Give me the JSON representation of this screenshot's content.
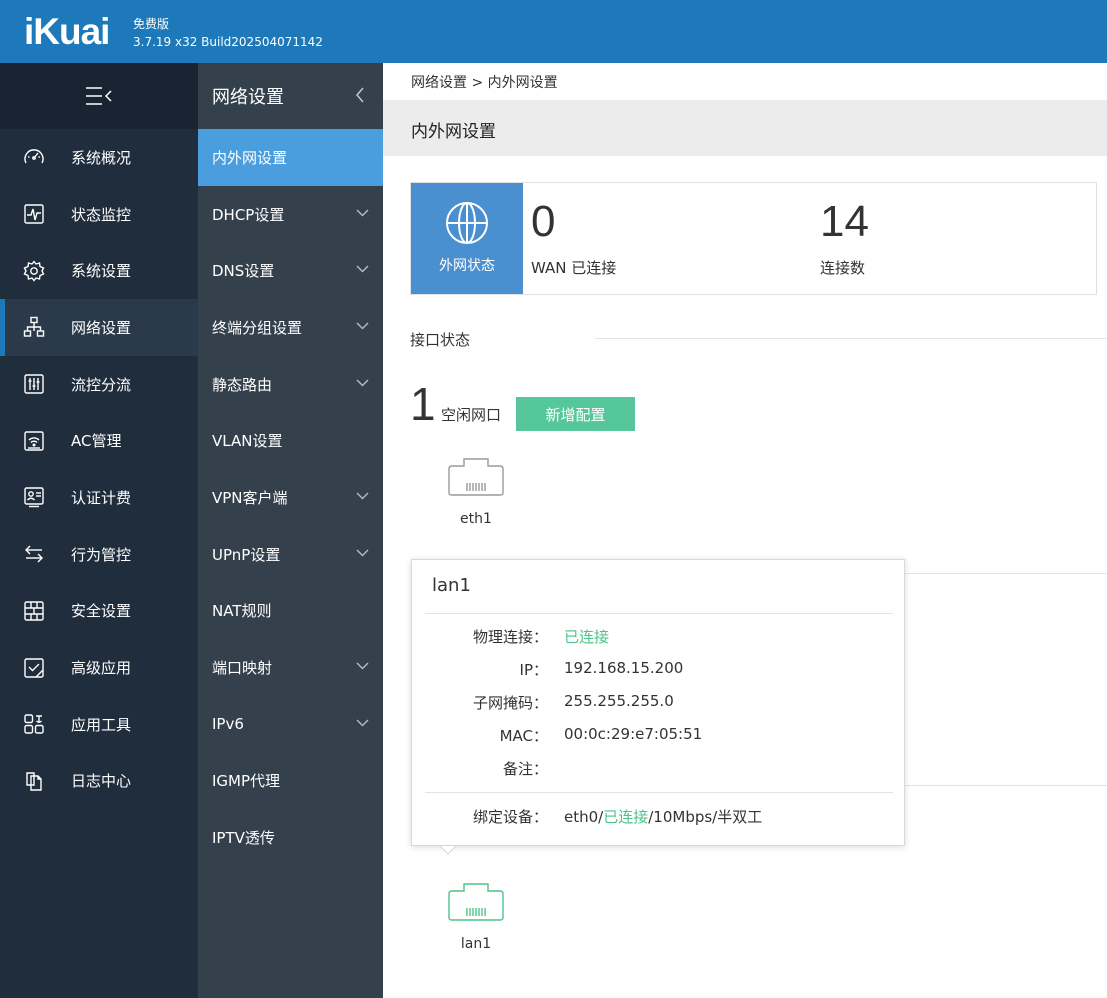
{
  "header": {
    "logo": "iKuai",
    "edition": "免费版",
    "build": "3.7.19 x32 Build202504071142",
    "bg_color": "#1d79b9"
  },
  "sidebar": {
    "items": [
      {
        "label": "系统概况",
        "icon": "speedometer-icon"
      },
      {
        "label": "状态监控",
        "icon": "heartbeat-monitor-icon"
      },
      {
        "label": "系统设置",
        "icon": "gear-icon"
      },
      {
        "label": "网络设置",
        "icon": "network-topology-icon",
        "active": true
      },
      {
        "label": "流控分流",
        "icon": "sliders-icon"
      },
      {
        "label": "AC管理",
        "icon": "wifi-router-icon"
      },
      {
        "label": "认证计费",
        "icon": "id-card-icon"
      },
      {
        "label": "行为管控",
        "icon": "swap-arrows-icon"
      },
      {
        "label": "安全设置",
        "icon": "firewall-icon"
      },
      {
        "label": "高级应用",
        "icon": "checklist-icon"
      },
      {
        "label": "应用工具",
        "icon": "apps-tools-icon"
      },
      {
        "label": "日志中心",
        "icon": "documents-icon"
      }
    ]
  },
  "subbar": {
    "title": "网络设置",
    "items": [
      {
        "label": "内外网设置",
        "expandable": false,
        "active": true
      },
      {
        "label": "DHCP设置",
        "expandable": true
      },
      {
        "label": "DNS设置",
        "expandable": true
      },
      {
        "label": "终端分组设置",
        "expandable": true
      },
      {
        "label": "静态路由",
        "expandable": true
      },
      {
        "label": "VLAN设置",
        "expandable": false
      },
      {
        "label": "VPN客户端",
        "expandable": true
      },
      {
        "label": "UPnP设置",
        "expandable": true
      },
      {
        "label": "NAT规则",
        "expandable": false
      },
      {
        "label": "端口映射",
        "expandable": true
      },
      {
        "label": "IPv6",
        "expandable": true
      },
      {
        "label": "IGMP代理",
        "expandable": false
      },
      {
        "label": "IPTV透传",
        "expandable": false
      }
    ]
  },
  "content": {
    "breadcrumb": "网络设置 > 内外网设置",
    "page_title": "内外网设置",
    "wan_status": {
      "badge_label": "外网状态",
      "wan_connected_value": "0",
      "wan_connected_label": "WAN 已连接",
      "connections_value": "14",
      "connections_label": "连接数"
    },
    "interface_section_title": "接口状态",
    "idle_count": "1",
    "idle_label": "空闲网口",
    "add_button": "新增配置",
    "ports": {
      "eth1": "eth1",
      "lan1": "lan1"
    },
    "popup": {
      "title": "lan1",
      "physical_label": "物理连接：",
      "physical_value": "已连接",
      "ip_label": "IP：",
      "ip_value": "192.168.15.200",
      "mask_label": "子网掩码：",
      "mask_value": "255.255.255.0",
      "mac_label": "MAC：",
      "mac_value": "00:0c:29:e7:05:51",
      "note_label": "备注：",
      "note_value": "",
      "bind_label": "绑定设备：",
      "bind_prefix": "eth0/",
      "bind_status": "已连接",
      "bind_suffix": "/10Mbps/半双工"
    }
  }
}
